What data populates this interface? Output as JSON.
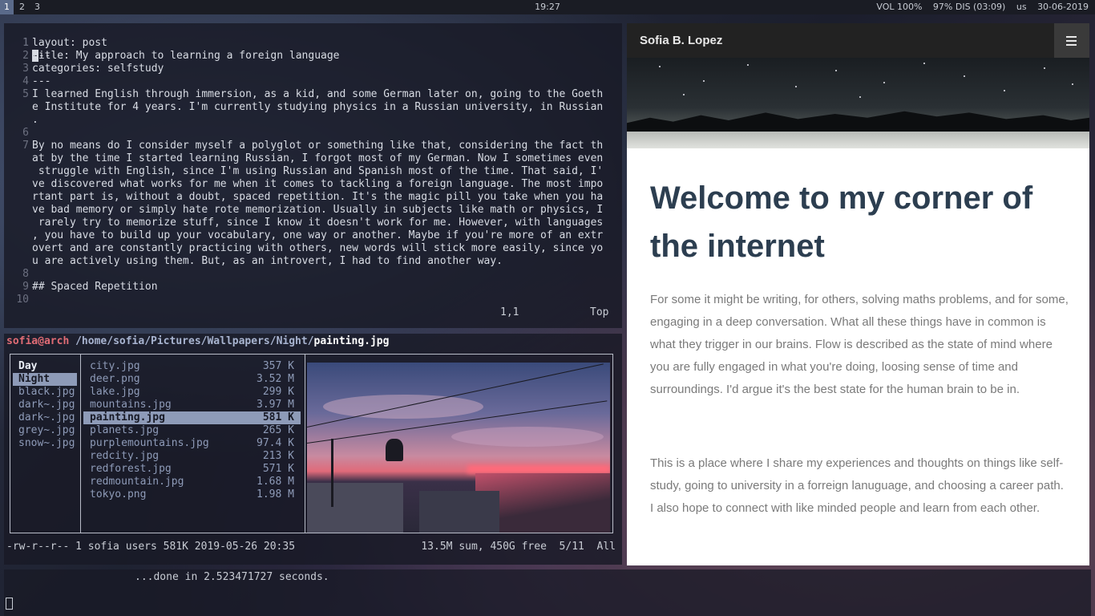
{
  "topbar": {
    "workspaces": [
      "1",
      "2",
      "3"
    ],
    "clock": "19:27",
    "volume": "VOL 100%",
    "battery": "97% DIS (03:09)",
    "layout": "us",
    "date": "30-06-2019"
  },
  "vim": {
    "lines": [
      {
        "n": "1",
        "t": "---"
      },
      {
        "n": "1",
        "t": "layout: post"
      },
      {
        "n": "2",
        "t": "title: My approach to learning a foreign language"
      },
      {
        "n": "3",
        "t": "categories: selfstudy"
      },
      {
        "n": "4",
        "t": "---"
      },
      {
        "n": "5",
        "t": "I learned English through immersion, as a kid, and some German later on, going to the Goeth"
      },
      {
        "n": "",
        "t": "e Institute for 4 years. I'm currently studying physics in a Russian university, in Russian"
      },
      {
        "n": "",
        "t": "."
      },
      {
        "n": "6",
        "t": ""
      },
      {
        "n": "7",
        "t": "By no means do I consider myself a polyglot or something like that, considering the fact th"
      },
      {
        "n": "",
        "t": "at by the time I started learning Russian, I forgot most of my German. Now I sometimes even"
      },
      {
        "n": "",
        "t": " struggle with English, since I'm using Russian and Spanish most of the time. That said, I'"
      },
      {
        "n": "",
        "t": "ve discovered what works for me when it comes to tackling a foreign language. The most impo"
      },
      {
        "n": "",
        "t": "rtant part is, without a doubt, spaced repetition. It's the magic pill you take when you ha"
      },
      {
        "n": "",
        "t": "ve bad memory or simply hate rote memorization. Usually in subjects like math or physics, I"
      },
      {
        "n": "",
        "t": " rarely try to memorize stuff, since I know it doesn't work for me. However, with languages"
      },
      {
        "n": "",
        "t": ", you have to build up your vocabulary, one way or another. Maybe if you're more of an extr"
      },
      {
        "n": "",
        "t": "overt and are constantly practicing with others, new words will stick more easily, since yo"
      },
      {
        "n": "",
        "t": "u are actively using them. But, as an introvert, I had to find another way."
      },
      {
        "n": "8",
        "t": ""
      },
      {
        "n": "9",
        "t": "## Spaced Repetition"
      },
      {
        "n": "10",
        "t": ""
      }
    ],
    "cursor_char": "-",
    "first_line_rest": "--",
    "position": "1,1",
    "scroll": "Top"
  },
  "ranger": {
    "user": "sofia@arch",
    "dir": "/home/sofia/Pictures/Wallpapers/Night/",
    "file": "painting.jpg",
    "parent_items": [
      {
        "name": "Day",
        "kind": "dir"
      },
      {
        "name": "Night",
        "kind": "sel"
      },
      {
        "name": "black.jpg",
        "kind": "file"
      },
      {
        "name": "dark~.jpg",
        "kind": "file"
      },
      {
        "name": "dark~.jpg",
        "kind": "file"
      },
      {
        "name": "grey~.jpg",
        "kind": "file"
      },
      {
        "name": "snow~.jpg",
        "kind": "file"
      }
    ],
    "files": [
      {
        "name": "city.jpg",
        "size": "357 K",
        "sel": false
      },
      {
        "name": "deer.png",
        "size": "3.52 M",
        "sel": false
      },
      {
        "name": "lake.jpg",
        "size": "299 K",
        "sel": false
      },
      {
        "name": "mountains.jpg",
        "size": "3.97 M",
        "sel": false
      },
      {
        "name": "painting.jpg",
        "size": "581 K",
        "sel": true
      },
      {
        "name": "planets.jpg",
        "size": "265 K",
        "sel": false
      },
      {
        "name": "purplemountains.jpg",
        "size": "97.4 K",
        "sel": false
      },
      {
        "name": "redcity.jpg",
        "size": "213 K",
        "sel": false
      },
      {
        "name": "redforest.jpg",
        "size": "571 K",
        "sel": false
      },
      {
        "name": "redmountain.jpg",
        "size": "1.68 M",
        "sel": false
      },
      {
        "name": "tokyo.png",
        "size": "1.98 M",
        "sel": false
      }
    ],
    "file_info": "-rw-r--r-- 1 sofia users 581K 2019-05-26 20:35",
    "summary": "13.5M sum, 450G free  5/11  All"
  },
  "shell": {
    "message": "...done in 2.523471727 seconds."
  },
  "browser": {
    "site_title": "Sofia B. Lopez",
    "menu_icon": "hamburger-icon",
    "heading": "Welcome to my corner of the internet",
    "paragraph1": "For some it might be writing, for others, solving maths problems, and for some, engaging in a deep conversation. What all these things have in common is what they trigger in our brains. Flow is described as the state of mind where you are fully engaged in what you're doing, loosing sense of time and surroundings. I'd argue it's the best state for the human brain to be in.",
    "paragraph2": "This is a place where I share my experiences and thoughts on things like self-study, going to university in a forreign lanuguage, and choosing a career path. I also hope to connect with like minded people and learn from each other."
  },
  "colors": {
    "user": "#e06c75",
    "selection": "#8e9bb8",
    "heading": "#2c3e50",
    "body_text": "#7a7a7a",
    "nav": "#222222"
  }
}
